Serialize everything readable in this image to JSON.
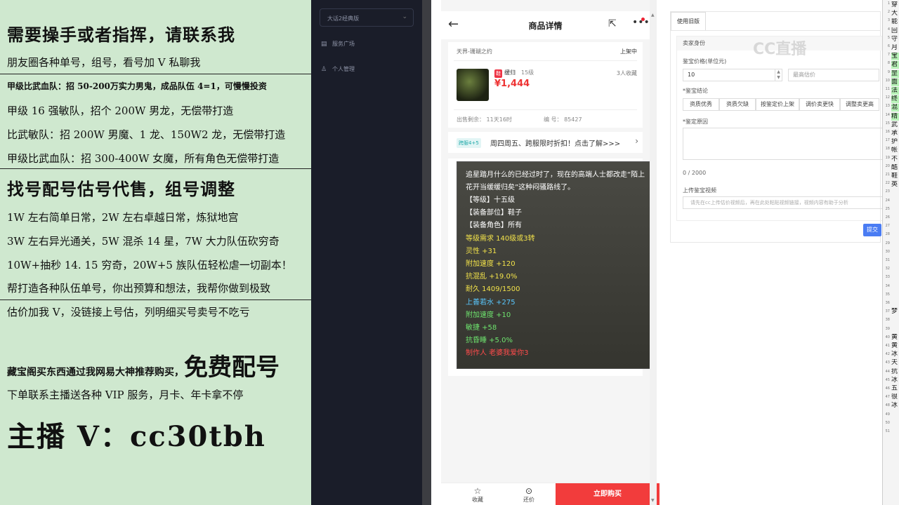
{
  "promo": {
    "l1": "需要操手或者指挥，请联系我",
    "l2": "朋友圈各种单号，组号，看号加 V 私聊我",
    "l3": "甲级比武血队：招 50-200万实力男鬼，成品队伍 4=1，可慢慢投资",
    "l4": "甲级 16 强敏队，招个 200W 男龙，无偿带打造",
    "l5": "比武敏队：招 200W 男魔、1 龙、150W2 龙，无偿带打造",
    "l6": "甲级比武血队：招 300-400W 女魔，所有角色无偿带打造",
    "l7": "找号配号估号代售，组号调整",
    "l8": "1W 左右简单日常，2W 左右卓越日常，炼狱地宫",
    "l9": "3W 左右异光通关，5W 混杀 14 星，7W 大力队伍砍穷奇",
    "l10": "10W+抽秒 14. 15 穷奇，20W+5 族队伍轻松虐一切副本！",
    "l11": "帮打造各种队伍单号，你出预算和想法，我帮你做到极致",
    "l12": "估价加我 V，没链接上号估，列明细买号卖号不吃亏",
    "l13a": "藏宝阁买东西通过我网易大神推荐购买，",
    "l13b": "免费配号",
    "l14": "下单联系主播送各种 VIP 服务，月卡、年卡拿不停",
    "l15": "主播 V：cc30tbh"
  },
  "sidebar": {
    "select_value": "大话2经典版",
    "items": [
      {
        "label": "服务广场",
        "icon": "file-icon"
      },
      {
        "label": "个人管理",
        "icon": "user-icon"
      }
    ]
  },
  "phone": {
    "title": "商品详情",
    "server": "天界-珊瑚之约",
    "status": "上架中",
    "item_tag": "鞋",
    "item_name": "缓归",
    "item_level": "15级",
    "price": "¥1,444",
    "fav_count": "3人收藏",
    "remain_label": "出售剩余：",
    "remain_value": "11天16时",
    "code_label": "编 号：",
    "code_value": "85427",
    "banner_badge": "跨服4+5",
    "banner_text": "周四周五、跨服限时折扣！点击了解>>>",
    "desc": "追星踏月什么的已经过时了，现在的高端人士都改走“陌上花开当缓缓归矣”这种闷骚路线了。",
    "attrs": [
      {
        "text": "【等级】十五级",
        "color": "w"
      },
      {
        "text": "【装备部位】鞋子",
        "color": "w"
      },
      {
        "text": "【装备角色】所有",
        "color": "w"
      },
      {
        "text": "等级需求 140级或3转",
        "color": "y"
      },
      {
        "text": "灵性 +31",
        "color": "y"
      },
      {
        "text": "附加速度 +120",
        "color": "y"
      },
      {
        "text": "抗混乱 +19.0%",
        "color": "y"
      },
      {
        "text": "耐久 1409/1500",
        "color": "y"
      },
      {
        "text": "上善若水 +275",
        "color": "c"
      },
      {
        "text": "附加速度 +10",
        "color": "g"
      },
      {
        "text": "敏捷 +58",
        "color": "g"
      },
      {
        "text": "抗昏睡 +5.0%",
        "color": "g"
      },
      {
        "text": "制作人 老婆我爱你3",
        "color": "r"
      }
    ],
    "fav_label": "收藏",
    "offer_label": "还价",
    "buy_label": "立即购买"
  },
  "form": {
    "tab": "使用旧版",
    "section": "卖家身份",
    "price_label": "鉴宝价格(单位元)",
    "price_value": "10",
    "max_placeholder": "最高估价",
    "result_label": "*鉴宝结论",
    "options": [
      "资质优秀",
      "资质欠缺",
      "按鉴定价上架",
      "调价卖更快",
      "调整卖更高"
    ],
    "reason_label": "*鉴定原因",
    "count": "0 / 2000",
    "video_label": "上传鉴宝视频",
    "video_placeholder": "请先在cc上传估价视频后，再在此处粘贴视频链接，视频内容有助于分析",
    "submit": "提交"
  },
  "watermark": "CC直播",
  "edge": {
    "numbers": [
      "1",
      "2",
      "3",
      "4",
      "5",
      "6",
      "7",
      "8",
      "9",
      "10",
      "11",
      "12",
      "13",
      "14",
      "15",
      "16",
      "17",
      "18",
      "19",
      "20",
      "21",
      "22",
      "23",
      "24",
      "25",
      "26",
      "27",
      "28",
      "29",
      "30",
      "31",
      "32",
      "33",
      "34",
      "35",
      "36",
      "37",
      "38",
      "39",
      "40",
      "41",
      "42",
      "43",
      "44",
      "45",
      "46",
      "47",
      "48",
      "49",
      "50",
      "51"
    ],
    "chars": [
      "穿",
      "大",
      "能",
      "回",
      "守",
      "月",
      "宝",
      "君",
      "罡",
      "面",
      "法",
      "终",
      "混",
      "精",
      "武",
      "承",
      "护",
      "帐",
      "不",
      "酷",
      "鞋",
      "英",
      "",
      "",
      "",
      "",
      "梦",
      "",
      "",
      "黄",
      "黄",
      "冰",
      "天",
      "抗",
      "冰",
      "五",
      "很",
      "冰"
    ]
  }
}
